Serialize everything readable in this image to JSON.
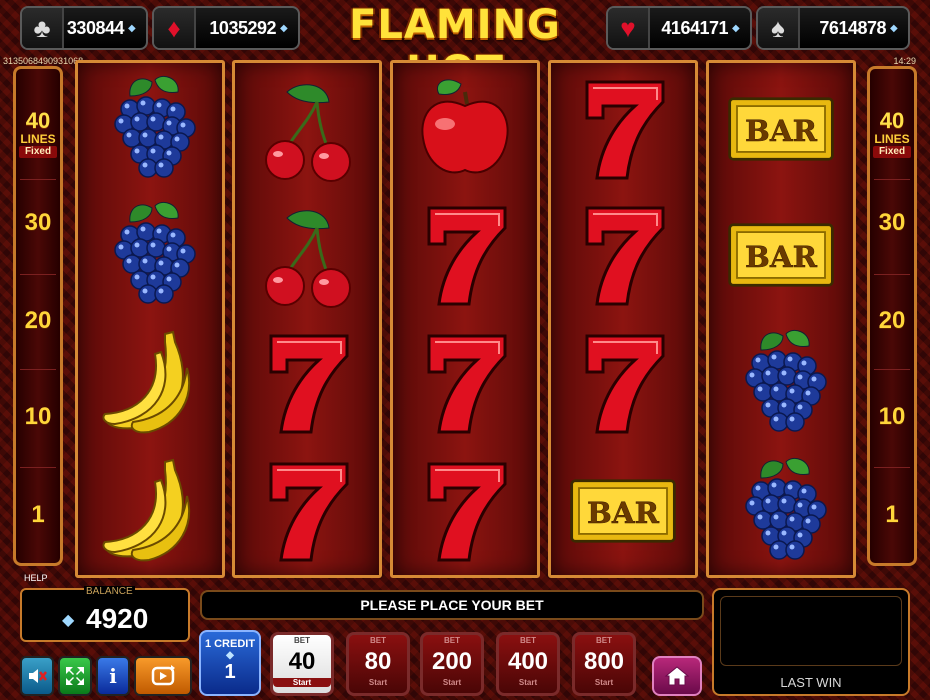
{
  "header": {
    "title": "FLAMING HOT",
    "jackpots": [
      {
        "suit": "club",
        "glyph": "♣",
        "value": "330844"
      },
      {
        "suit": "diamond",
        "glyph": "♦",
        "value": "1035292"
      },
      {
        "suit": "heart",
        "glyph": "♥",
        "value": "4164171"
      },
      {
        "suit": "spade",
        "glyph": "♠",
        "value": "7614878"
      }
    ],
    "ticket_id": "3135068490931068",
    "time": "14:29"
  },
  "lines_panel": {
    "count": "40",
    "label": "LINES",
    "mode": "Fixed",
    "steps": [
      "30",
      "20",
      "10",
      "1"
    ]
  },
  "reels": [
    [
      "grapes",
      "grapes",
      "banana",
      "banana"
    ],
    [
      "cherry",
      "cherry",
      "seven",
      "seven"
    ],
    [
      "apple",
      "seven",
      "seven",
      "seven"
    ],
    [
      "seven",
      "seven",
      "seven",
      "bar"
    ],
    [
      "bar",
      "bar",
      "grapes",
      "grapes"
    ]
  ],
  "bar_text": "BAR",
  "bottom": {
    "help_label": "HELP",
    "balance_label": "BALANCE",
    "balance": "4920",
    "message": "PLEASE PLACE YOUR BET",
    "last_win_label": "LAST WIN",
    "credit": {
      "label": "1 CREDIT",
      "value": "1"
    },
    "bet_caption": "BET",
    "start_caption": "Start",
    "bets": [
      "40",
      "80",
      "200",
      "400",
      "800"
    ],
    "info_glyph": "i"
  },
  "colors": {
    "accent_gold": "#ffe23a",
    "reel_frame": "#d68a35",
    "diamond": "#9fd8ff"
  }
}
